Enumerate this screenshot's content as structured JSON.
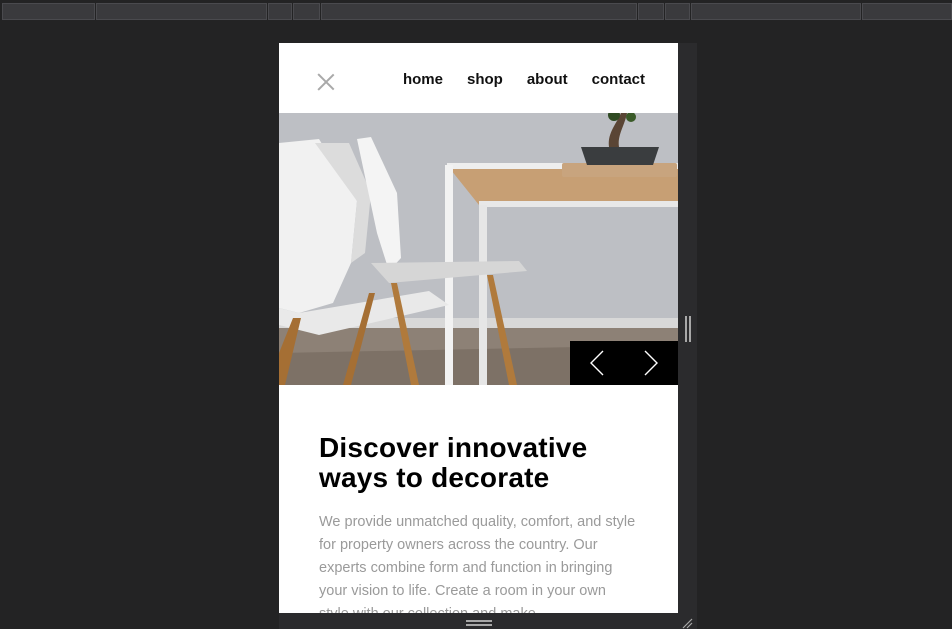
{
  "nav": {
    "close_icon": "close-icon",
    "links": [
      "home",
      "shop",
      "about",
      "contact"
    ]
  },
  "hero": {
    "prev_icon": "chevron-left-icon",
    "next_icon": "chevron-right-icon"
  },
  "content": {
    "headline": "Discover innovative ways to decorate",
    "body": "We provide unmatched quality, comfort, and style for property owners across the country. Our experts combine form and function in bringing your vision to life. Create a room in your own style with our collection and make"
  },
  "colors": {
    "page_bg": "#232324",
    "text_dark": "#111111",
    "text_muted": "#9a9a9a",
    "control_bg": "#000000"
  }
}
